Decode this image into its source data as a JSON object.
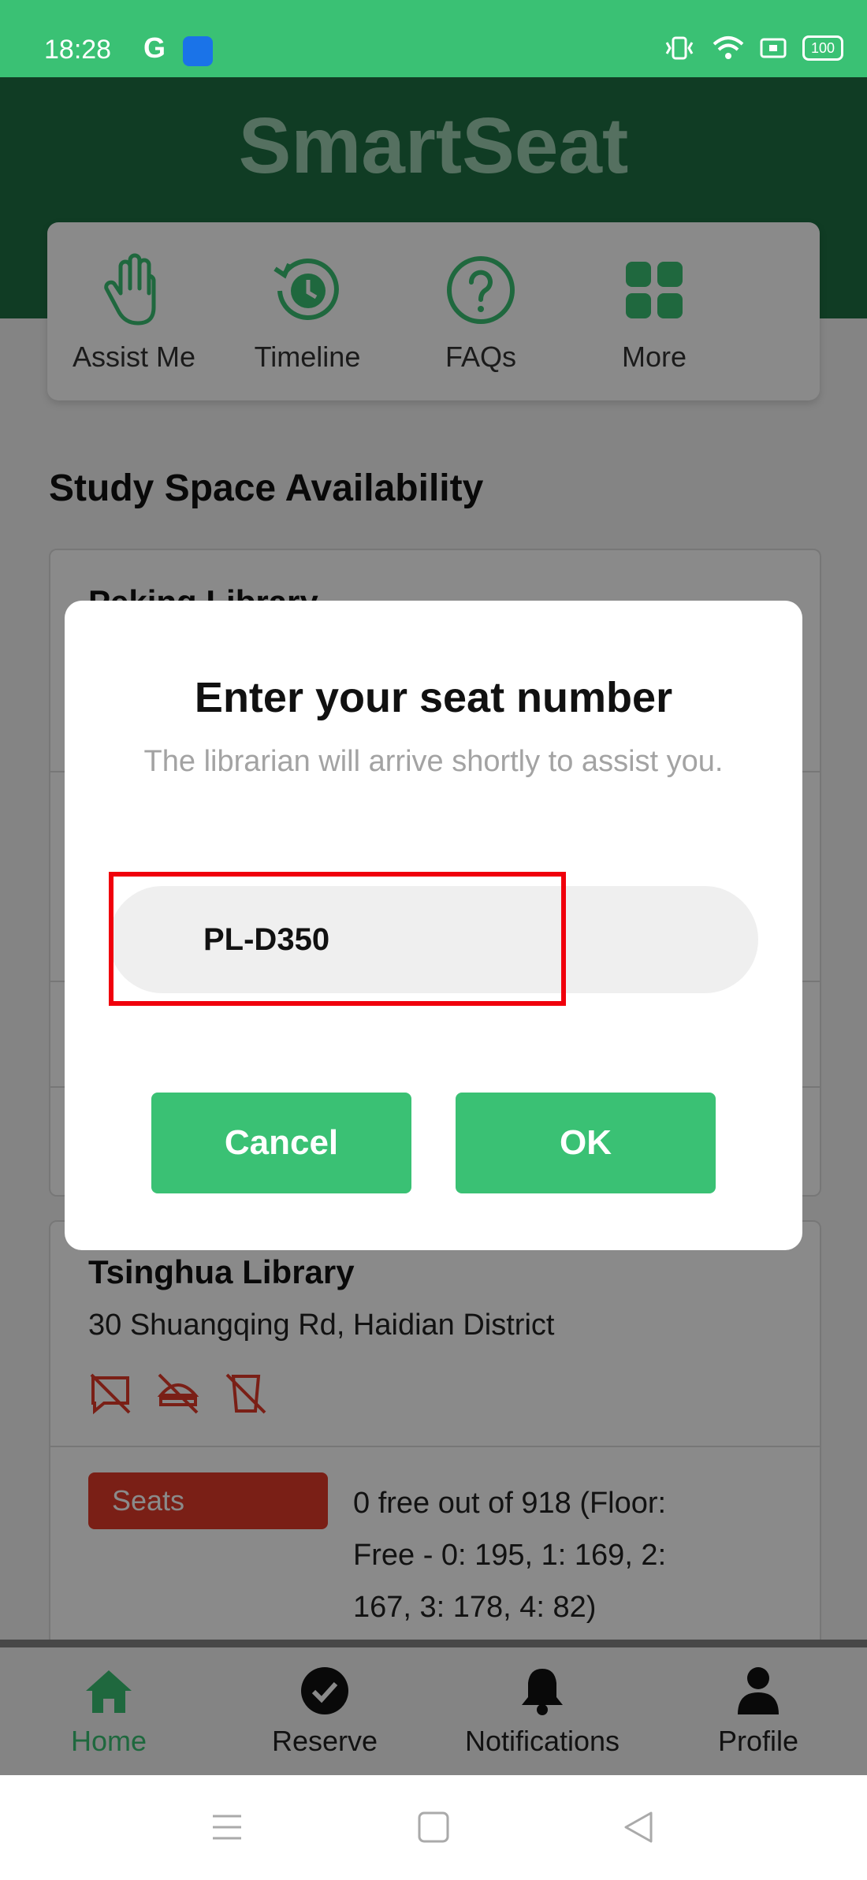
{
  "status_bar": {
    "time": "18:28",
    "g_letter": "G",
    "battery": "100"
  },
  "app": {
    "title": "SmartSeat"
  },
  "quick_actions": [
    {
      "label": "Assist Me",
      "icon": "hand-icon"
    },
    {
      "label": "Timeline",
      "icon": "history-icon"
    },
    {
      "label": "FAQs",
      "icon": "question-icon"
    },
    {
      "label": "More",
      "icon": "grid-icon"
    }
  ],
  "section": {
    "title": "Study Space Availability"
  },
  "libraries": [
    {
      "name": "Peking Library"
    },
    {
      "name": "Tsinghua Library",
      "address": "30 Shuangqing Rd, Haidian District",
      "seats_badge": "Seats",
      "seats_text": "0 free out of 918 (Floor: Free - 0: 195, 1: 169, 2: 167, 3: 178, 4: 82)"
    }
  ],
  "dialog": {
    "title": "Enter your seat number",
    "message": "The librarian will arrive shortly to assist you.",
    "input_value": "PL-D350",
    "cancel": "Cancel",
    "ok": "OK"
  },
  "bottom_nav": [
    {
      "label": "Home",
      "active": true
    },
    {
      "label": "Reserve",
      "active": false
    },
    {
      "label": "Notifications",
      "active": false
    },
    {
      "label": "Profile",
      "active": false
    }
  ],
  "colors": {
    "brand_green": "#3ac174",
    "header_green": "#1e6f43",
    "alert_red": "#e23a2a",
    "highlight_red": "#f0000c"
  }
}
